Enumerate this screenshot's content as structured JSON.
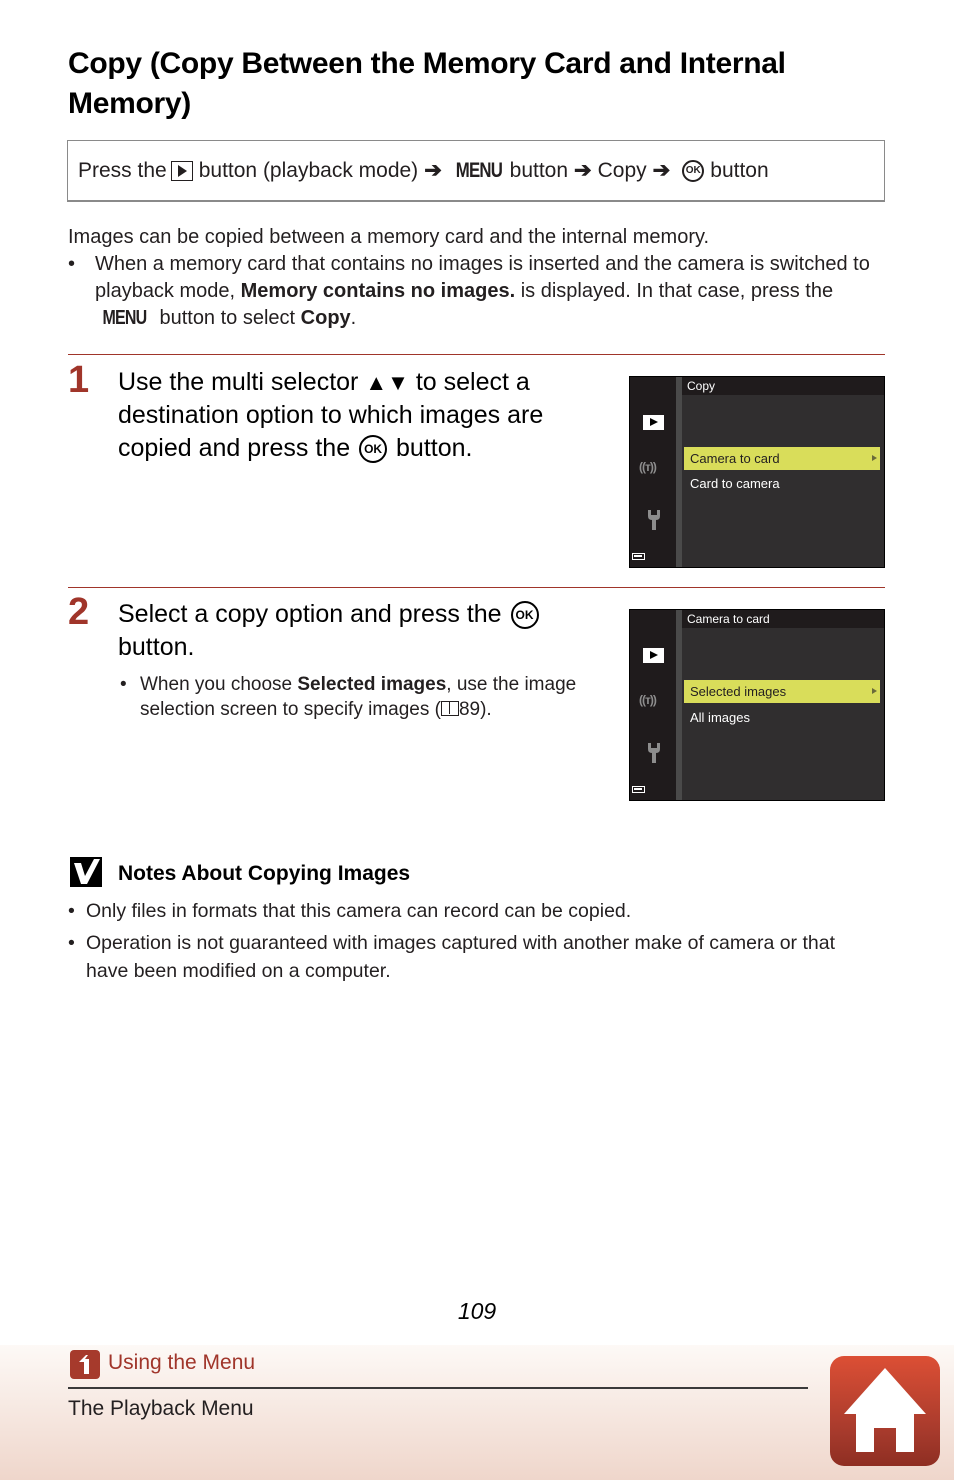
{
  "title": "Copy (Copy Between the Memory Card and Internal Memory)",
  "nav_path": {
    "press_the": "Press the",
    "playback_button_suffix": "button (playback mode)",
    "arrow": "➔",
    "menu_label": "MENU",
    "menu_button_suffix": "button",
    "copy": "Copy",
    "ok_label": "OK",
    "ok_button_suffix": "button"
  },
  "intro": {
    "paragraph": "Images can be copied between a memory card and the internal memory.",
    "bullet_dot": "•",
    "bullet_part1": "When a memory card that contains no images is inserted and the camera is switched to playback mode,",
    "bullet_bold1": "Memory contains no images.",
    "bullet_part2": "is displayed. In that case, press the",
    "bullet_menu": "MENU",
    "bullet_part3": "button to select",
    "bullet_bold2": "Copy",
    "bullet_end": "."
  },
  "steps": [
    {
      "number": "1",
      "text_part1": "Use the multi selector",
      "arrows": "▲▼",
      "text_part2": "to select a destination option to which images are copied and press the",
      "ok_label": "OK",
      "text_part3": "button.",
      "screen": {
        "header": "Copy",
        "items": [
          {
            "label": "Camera to card",
            "selected": true
          },
          {
            "label": "Card to camera",
            "selected": false
          }
        ]
      }
    },
    {
      "number": "2",
      "text_part1": "Select a copy option and press the",
      "ok_label": "OK",
      "text_part2": "button.",
      "sub_bullet": {
        "dot": "•",
        "part1": "When you choose",
        "bold": "Selected images",
        "part2": ", use the image selection screen to specify images (",
        "page_ref": "89",
        "part3": ")."
      },
      "screen": {
        "header": "Camera to card",
        "items": [
          {
            "label": "Selected images",
            "selected": true
          },
          {
            "label": "All images",
            "selected": false
          }
        ]
      }
    }
  ],
  "camera_screen_icons": {
    "wifi": "((ᴛ))"
  },
  "notes": {
    "title": "Notes About Copying Images",
    "bullet_dot": "•",
    "items": [
      "Only files in formats that this camera can record can be copied.",
      "Operation is not guaranteed with images captured with another make of camera or that have been modified on a computer."
    ]
  },
  "page_number": "109",
  "footer": {
    "back_link": "Using the Menu",
    "section": "The Playback Menu"
  },
  "colors": {
    "accent_red": "#a0352a",
    "menu_highlight": "#d9dd5a"
  }
}
